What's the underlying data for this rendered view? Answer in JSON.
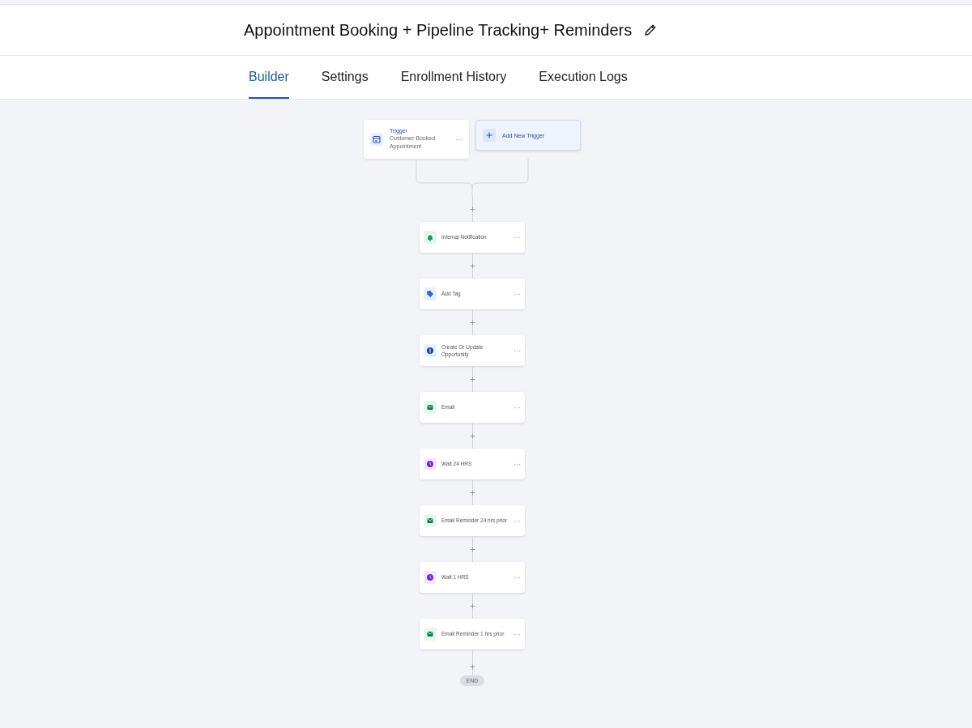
{
  "title": "Appointment Booking + Pipeline Tracking+ Reminders",
  "tabs": [
    {
      "label": "Builder",
      "selected": true
    },
    {
      "label": "Settings",
      "selected": false
    },
    {
      "label": "Enrollment History",
      "selected": false
    },
    {
      "label": "Execution Logs",
      "selected": false
    }
  ],
  "trigger": {
    "label": "Trigger",
    "name": "Customer Booked Appointment"
  },
  "add_trigger": {
    "label": "Add New Trigger"
  },
  "steps": [
    {
      "kind": "notification",
      "label": "Internal Notification"
    },
    {
      "kind": "tag",
      "label": "Add Tag"
    },
    {
      "kind": "opportunity",
      "label": "Create Or Update Opportunity"
    },
    {
      "kind": "email",
      "label": "Email"
    },
    {
      "kind": "wait",
      "label": "Wait 24 HRS"
    },
    {
      "kind": "email",
      "label": "Email Reminder 24 hrs prior"
    },
    {
      "kind": "wait",
      "label": "Wait 1 HRS"
    },
    {
      "kind": "email",
      "label": "Email Reminder 1 hrs prior"
    }
  ],
  "end_label": "END"
}
